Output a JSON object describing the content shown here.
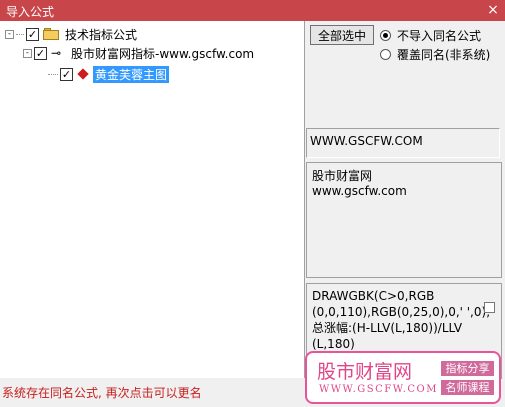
{
  "window": {
    "title": "导入公式",
    "close_glyph": "×"
  },
  "tree": {
    "root": {
      "label": "技术指标公式",
      "expander": "-",
      "checked": "✓"
    },
    "child": {
      "label": "股市财富网指标-www.gscfw.com",
      "expander": "-",
      "checked": "✓"
    },
    "leaf": {
      "label": "黄金芙蓉主图",
      "checked": "✓"
    }
  },
  "controls": {
    "select_all_label": "全部选中",
    "radio_options": [
      "不导入同名公式",
      "覆盖同名(非系统)"
    ],
    "selected_radio": 0
  },
  "info": {
    "url_text": "WWW.GSCFW.COM",
    "description_lines": [
      "股市财富网",
      "www.gscfw.com"
    ],
    "code_lines": [
      "DRAWGBK(C>0,RGB",
      "(0,0,110),RGB(0,25,0),0,' ',0);",
      "总涨幅:(H-LLV(L,180))/LLV",
      "(L,180)"
    ]
  },
  "status_message": "系统存在同名公式, 再次点击可以更名",
  "watermark": {
    "title": "股市财富网",
    "url": "WWW.GSCFW.COM",
    "tag1": "指标分享",
    "tag2": "名师课程"
  },
  "colors": {
    "titlebar": "#c8464a",
    "selection": "#3399ff",
    "status_text": "#c81e1e",
    "watermark_accent": "#e04789"
  }
}
